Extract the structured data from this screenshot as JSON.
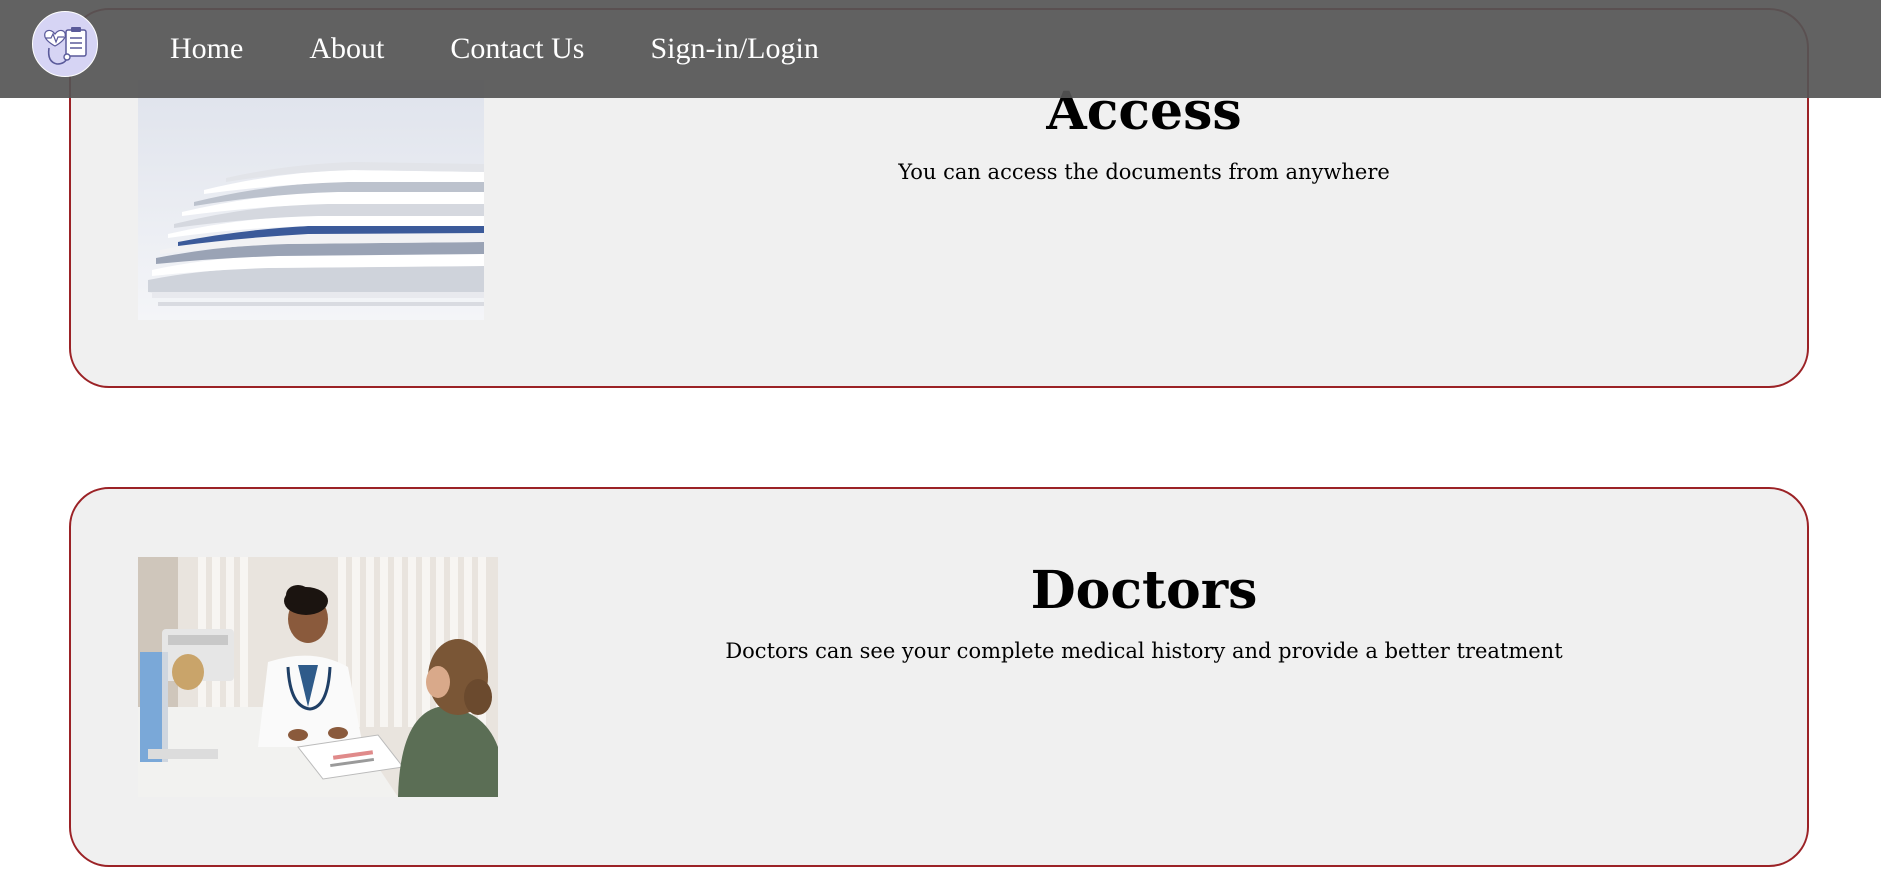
{
  "nav": {
    "links": [
      {
        "label": "Home"
      },
      {
        "label": "About"
      },
      {
        "label": "Contact Us"
      },
      {
        "label": "Sign-in/Login"
      }
    ],
    "logo_icon": "medical-records-stethoscope-icon"
  },
  "features": [
    {
      "title": "Access",
      "description": "You can access the documents from anywhere",
      "image": "stack-of-documents-photo"
    },
    {
      "title": "Doctors",
      "description": "Doctors can see your complete medical history and provide a better treatment",
      "image": "doctor-consulting-patient-photo"
    }
  ],
  "colors": {
    "card_border": "#9b2226",
    "card_background": "#f0f0f0",
    "navbar_background": "#555555",
    "logo_background": "#d6d4f4"
  }
}
